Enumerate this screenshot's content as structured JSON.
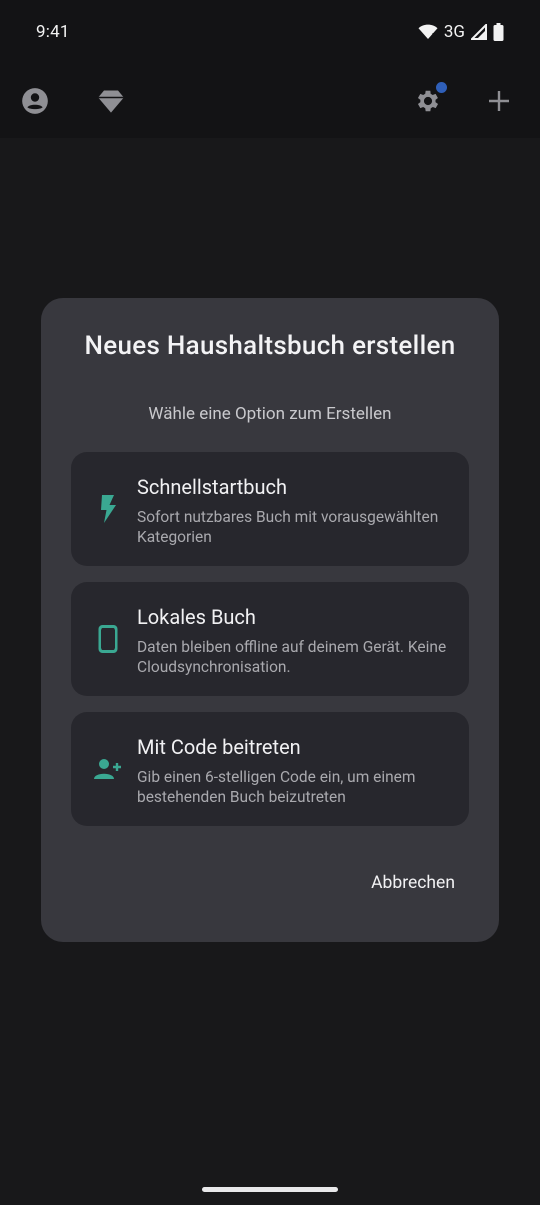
{
  "status_bar": {
    "time": "9:41",
    "network": "3G",
    "icons": [
      "wifi-icon",
      "signal-icon",
      "battery-icon"
    ]
  },
  "app_bar": {
    "icons": [
      "account-icon",
      "premium-diamond-icon",
      "settings-icon",
      "add-icon"
    ],
    "settings_has_notification": true
  },
  "dialog": {
    "title": "Neues Haushaltsbuch erstellen",
    "subtitle": "Wähle eine Option zum Erstellen",
    "options": [
      {
        "title": "Schnellstartbuch",
        "description": "Sofort nutzbares Buch mit vorausgewählten Kategorien",
        "icon": "lightning-icon"
      },
      {
        "title": "Lokales Buch",
        "description": "Daten bleiben offline auf deinem Gerät. Keine Cloudsynchronisation.",
        "icon": "phone-icon"
      },
      {
        "title": "Mit Code beitreten",
        "description": "Gib einen 6-stelligen Code ein, um einem bestehenden Buch beizutreten",
        "icon": "add-person-icon"
      }
    ],
    "cancel_label": "Abbrechen"
  },
  "colors": {
    "accent": "#3aa892",
    "notification_dot": "#2f5fb8",
    "dialog_bg": "#38383e",
    "option_bg": "#27272d"
  }
}
